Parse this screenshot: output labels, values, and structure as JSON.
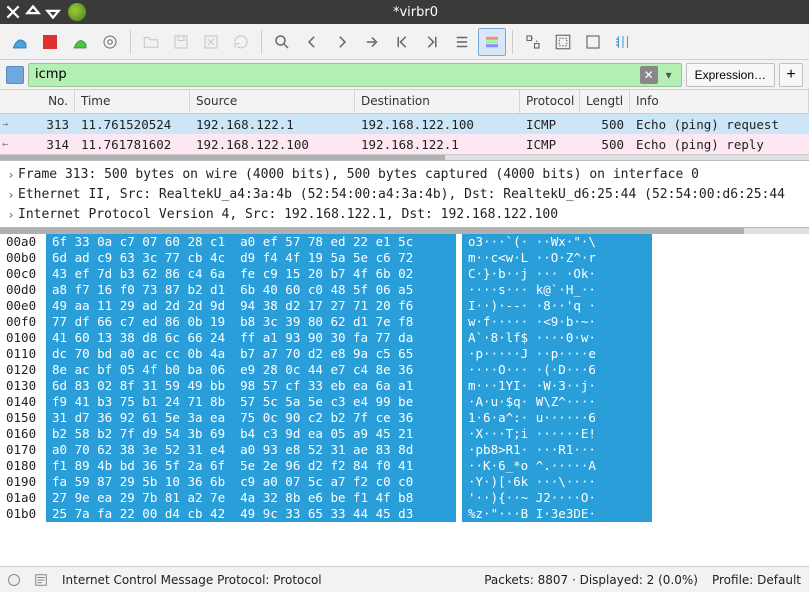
{
  "titlebar": {
    "title": "*virbr0"
  },
  "filter": {
    "value": "icmp",
    "expression_label": "Expression…"
  },
  "packet_list": {
    "headers": {
      "no": "No.",
      "time": "Time",
      "src": "Source",
      "dst": "Destination",
      "proto": "Protocol",
      "len": "Lengtl",
      "info": "Info"
    },
    "rows": [
      {
        "no": "313",
        "time": "11.761520524",
        "src": "192.168.122.1",
        "dst": "192.168.122.100",
        "proto": "ICMP",
        "len": "500",
        "info": "Echo (ping) request"
      },
      {
        "no": "314",
        "time": "11.761781602",
        "src": "192.168.122.100",
        "dst": "192.168.122.1",
        "proto": "ICMP",
        "len": "500",
        "info": "Echo (ping) reply"
      }
    ]
  },
  "details": {
    "rows": [
      "Frame 313: 500 bytes on wire (4000 bits), 500 bytes captured (4000 bits) on interface 0",
      "Ethernet II, Src: RealtekU_a4:3a:4b (52:54:00:a4:3a:4b), Dst: RealtekU_d6:25:44 (52:54:00:d6:25:44",
      "Internet Protocol Version 4, Src: 192.168.122.1, Dst: 192.168.122.100"
    ]
  },
  "hex": {
    "rows": [
      {
        "off": "00a0",
        "b": "6f 33 0a c7 07 60 28 c1  a0 ef 57 78 ed 22 e1 5c",
        "a": "o3···`(· ··Wx·\"·\\"
      },
      {
        "off": "00b0",
        "b": "6d ad c9 63 3c 77 cb 4c  d9 f4 4f 19 5a 5e c6 72",
        "a": "m··c<w·L ··O·Z^·r"
      },
      {
        "off": "00c0",
        "b": "43 ef 7d b3 62 86 c4 6a  fe c9 15 20 b7 4f 6b 02",
        "a": "C·}·b··j ··· ·Ok·"
      },
      {
        "off": "00d0",
        "b": "a8 f7 16 f0 73 87 b2 d1  6b 40 60 c0 48 5f 06 a5",
        "a": "····s··· k@`·H_··"
      },
      {
        "off": "00e0",
        "b": "49 aa 11 29 ad 2d 2d 9d  94 38 d2 17 27 71 20 f6",
        "a": "I··)·--· ·8··'q ·"
      },
      {
        "off": "00f0",
        "b": "77 df 66 c7 ed 86 0b 19  b8 3c 39 80 62 d1 7e f8",
        "a": "w·f····· ·<9·b·~·"
      },
      {
        "off": "0100",
        "b": "41 60 13 38 d8 6c 66 24  ff a1 93 90 30 fa 77 da",
        "a": "A`·8·lf$ ····0·w·"
      },
      {
        "off": "0110",
        "b": "dc 70 bd a0 ac cc 0b 4a  b7 a7 70 d2 e8 9a c5 65",
        "a": "·p·····J ··p····e"
      },
      {
        "off": "0120",
        "b": "8e ac bf 05 4f b0 ba 06  e9 28 0c 44 e7 c4 8e 36",
        "a": "····O··· ·(·D···6"
      },
      {
        "off": "0130",
        "b": "6d 83 02 8f 31 59 49 bb  98 57 cf 33 eb ea 6a a1",
        "a": "m···1YI· ·W·3··j·"
      },
      {
        "off": "0140",
        "b": "f9 41 b3 75 b1 24 71 8b  57 5c 5a 5e c3 e4 99 be",
        "a": "·A·u·$q· W\\Z^····"
      },
      {
        "off": "0150",
        "b": "31 d7 36 92 61 5e 3a ea  75 0c 90 c2 b2 7f ce 36",
        "a": "1·6·a^:· u······6"
      },
      {
        "off": "0160",
        "b": "b2 58 b2 7f d9 54 3b 69  b4 c3 9d ea 05 a9 45 21",
        "a": "·X···T;i ······E!"
      },
      {
        "off": "0170",
        "b": "a0 70 62 38 3e 52 31 e4  a0 93 e8 52 31 ae 83 8d",
        "a": "·pb8>R1· ···R1···"
      },
      {
        "off": "0180",
        "b": "f1 89 4b bd 36 5f 2a 6f  5e 2e 96 d2 f2 84 f0 41",
        "a": "··K·6_*o ^.·····A"
      },
      {
        "off": "0190",
        "b": "fa 59 87 29 5b 10 36 6b  c9 a0 07 5c a7 f2 c0 c0",
        "a": "·Y·)[·6k ···\\····"
      },
      {
        "off": "01a0",
        "b": "27 9e ea 29 7b 81 a2 7e  4a 32 8b e6 be f1 4f b8",
        "a": "'··){··~ J2····O·"
      },
      {
        "off": "01b0",
        "b": "25 7a fa 22 00 d4 cb 42  49 9c 33 65 33 44 45 d3",
        "a": "%z·\"···B I·3e3DE·"
      }
    ]
  },
  "status": {
    "proto": "Internet Control Message Protocol: Protocol",
    "packets": "Packets: 8807 · Displayed: 2 (0.0%)",
    "profile": "Profile: Default"
  }
}
